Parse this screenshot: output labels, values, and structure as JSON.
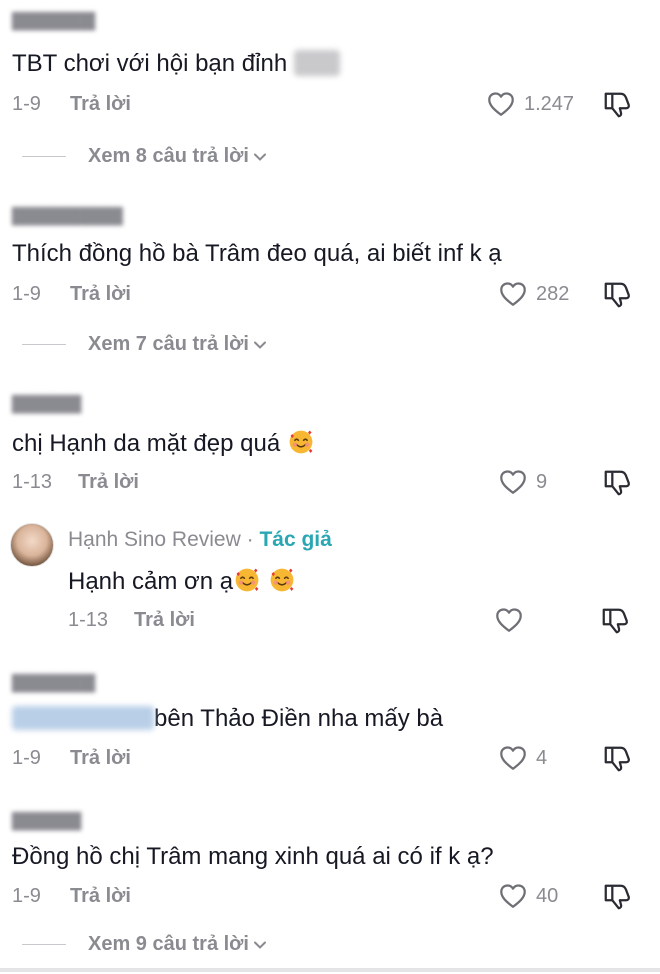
{
  "comments": [
    {
      "text": "TBT chơi với hội bạn đỉnh",
      "date": "1-9",
      "reply": "Trả lời",
      "likes": "1.247",
      "view_replies": "Xem 8 câu trả lời"
    },
    {
      "text": "Thích đồng hồ bà Trâm đeo quá, ai biết inf k ạ",
      "date": "1-9",
      "reply": "Trả lời",
      "likes": "282",
      "view_replies": "Xem 7 câu trả lời"
    },
    {
      "text": "chị Hạnh da mặt đẹp quá",
      "date": "1-13",
      "reply": "Trả lời",
      "likes": "9",
      "emoji": "smiling-face-with-hearts"
    },
    {
      "author": "Hạnh Sino Review",
      "separator": " · ",
      "author_tag": "Tác giả",
      "text": "Hạnh cảm ơn ạ",
      "date": "1-13",
      "reply": "Trả lời",
      "emoji": "smiling-face-with-hearts"
    },
    {
      "text": "bên Thảo Điền nha mấy bà",
      "date": "1-9",
      "reply": "Trả lời",
      "likes": "4"
    },
    {
      "text": "Đồng hồ chị Trâm mang xinh quá ai có if k ạ?",
      "date": "1-9",
      "reply": "Trả lời",
      "likes": "40",
      "view_replies": "Xem 9 câu trả lời"
    }
  ],
  "colors": {
    "text": "#161823",
    "muted": "#8a8b91",
    "author_tag": "#2aa7b3",
    "emoji": "#f7b733"
  },
  "icons": [
    "heart-icon",
    "dislike-icon",
    "chevron-down-icon",
    "avatar"
  ]
}
